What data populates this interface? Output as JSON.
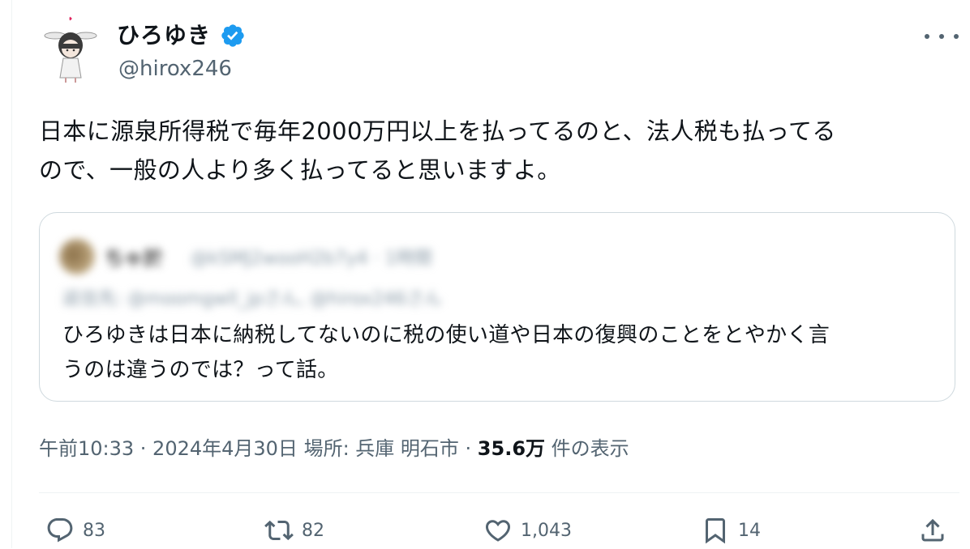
{
  "author": {
    "display_name": "ひろゆき",
    "handle": "@hirox246",
    "verified": true,
    "verified_color": "#1d9bf0"
  },
  "tweet": {
    "text_line1": "日本に源泉所得税で毎年2000万円以上を払ってるのと、法人税も払ってる",
    "text_line2": "ので、一般の人より多く払ってると思いますよ。"
  },
  "quoted_tweet": {
    "name": "ちゃ於",
    "meta": "@kSMJ2wooH2b7y4 · 1時間",
    "reply_to": "返信先: @moomgwll_jpさん, @hirox246さん",
    "text_line1": "ひろゆきは日本に納税してないのに税の使い道や日本の復興のことをとやかく言",
    "text_line2": "うのは違うのでは？って話。"
  },
  "metadata": {
    "time_date_location": "午前10:33 · 2024年4月30日 場所: 兵庫 明石市 · ",
    "views_count": "35.6万",
    "views_label": " 件の表示"
  },
  "actions": {
    "replies": "83",
    "reposts": "82",
    "likes": "1,043",
    "bookmarks": "14"
  },
  "icons": [
    "more-icon",
    "reply-icon",
    "repost-icon",
    "like-icon",
    "bookmark-icon",
    "share-icon",
    "verified-badge-icon"
  ],
  "colors": {
    "text": "#0f1419",
    "secondary": "#536471",
    "border": "#cfd9de"
  }
}
